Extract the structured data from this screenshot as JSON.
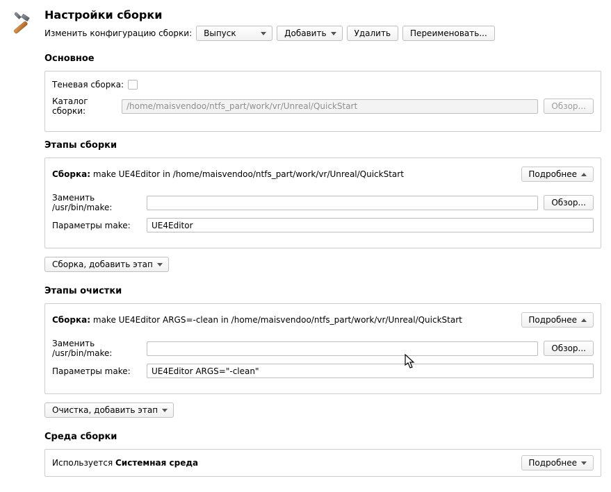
{
  "page": {
    "title": "Настройки сборки",
    "config_label": "Изменить конфигурацию сборки:"
  },
  "config_bar": {
    "selected": "Выпуск",
    "add_label": "Добавить",
    "delete_label": "Удалить",
    "rename_label": "Переименовать..."
  },
  "section_main": {
    "title": "Основное",
    "shadow_label": "Теневая сборка:",
    "catalog_label": "Каталог сборки:",
    "catalog_value": "/home/maisvendoo/ntfs_part/work/vr/Unreal/QuickStart",
    "browse_label": "Обзор..."
  },
  "section_build": {
    "title": "Этапы сборки",
    "header_label": "Сборка:",
    "header_desc": "make UE4Editor in /home/maisvendoo/ntfs_part/work/vr/Unreal/QuickStart",
    "details_label": "Подробнее",
    "replace_label": "Заменить /usr/bin/make:",
    "replace_value": "",
    "browse_label": "Обзор...",
    "params_label": "Параметры make:",
    "params_value": "UE4Editor",
    "add_step_label": "Сборка, добавить этап"
  },
  "section_clean": {
    "title": "Этапы очистки",
    "header_label": "Сборка:",
    "header_desc": "make UE4Editor ARGS=-clean in /home/maisvendoo/ntfs_part/work/vr/Unreal/QuickStart",
    "details_label": "Подробнее",
    "replace_label": "Заменить /usr/bin/make:",
    "replace_value": "",
    "browse_label": "Обзор...",
    "params_label": "Параметры make:",
    "params_value": "UE4Editor ARGS=\"-clean\"",
    "add_step_label": "Очистка, добавить этап"
  },
  "section_env": {
    "title": "Среда сборки",
    "text_prefix": "Используется ",
    "text_bold": "Системная среда",
    "details_label": "Подробнее"
  }
}
